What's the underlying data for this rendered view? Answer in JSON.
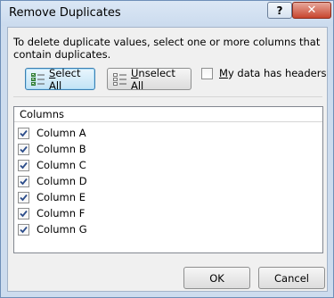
{
  "window": {
    "title": "Remove Duplicates",
    "help_label": "?",
    "close_label": "✕"
  },
  "instructions": "To delete duplicate values, select one or more columns that contain duplicates.",
  "buttons": {
    "select_all_prefix": "",
    "select_all_u": "S",
    "select_all_rest": "elect All",
    "unselect_all_u": "U",
    "unselect_all_rest": "nselect All",
    "ok": "OK",
    "cancel": "Cancel"
  },
  "headers_checkbox": {
    "label_u": "M",
    "label_rest": "y data has headers",
    "checked": false
  },
  "columns": {
    "header": "Columns",
    "items": [
      {
        "label": "Column A",
        "checked": true
      },
      {
        "label": "Column B",
        "checked": true
      },
      {
        "label": "Column C",
        "checked": true
      },
      {
        "label": "Column D",
        "checked": true
      },
      {
        "label": "Column E",
        "checked": true
      },
      {
        "label": "Column F",
        "checked": true
      },
      {
        "label": "Column G",
        "checked": true
      }
    ]
  },
  "colors": {
    "accent": "#3c7fb1",
    "check": "#2b4c8a"
  }
}
